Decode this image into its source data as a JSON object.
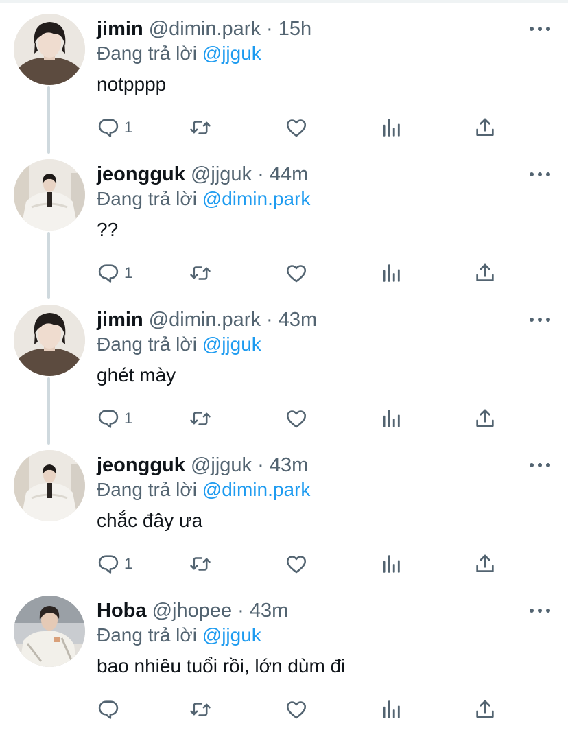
{
  "ui": {
    "reply_label": "Đang trả lời",
    "dot": "·"
  },
  "tweets": [
    {
      "name": "jimin",
      "handle": "@dimin.park",
      "time": "15h",
      "reply_to": "@jjguk",
      "text": "notpppp",
      "reply_count": "1",
      "avatar": "avatar-jimin"
    },
    {
      "name": "jeongguk",
      "handle": "@jjguk",
      "time": "44m",
      "reply_to": "@dimin.park",
      "text": "??",
      "reply_count": "1",
      "avatar": "avatar-jeongguk"
    },
    {
      "name": "jimin",
      "handle": "@dimin.park",
      "time": "43m",
      "reply_to": "@jjguk",
      "text": "ghét mày",
      "reply_count": "1",
      "avatar": "avatar-jimin"
    },
    {
      "name": "jeongguk",
      "handle": "@jjguk",
      "time": "43m",
      "reply_to": "@dimin.park",
      "text": "chắc đây ưa",
      "reply_count": "1",
      "avatar": "avatar-jeongguk"
    },
    {
      "name": "Hoba",
      "handle": "@jhopee",
      "time": "43m",
      "reply_to": "@jjguk",
      "text": "bao nhiêu tuổi rồi, lớn dùm đi",
      "reply_count": "",
      "avatar": "avatar-hoba"
    }
  ],
  "colors": {
    "accent": "#1d9bf0",
    "secondary_text": "#536471",
    "primary_text": "#0f1419",
    "thread_line": "#cfd9de"
  },
  "icons": [
    "reply-icon",
    "retweet-icon",
    "like-icon",
    "views-icon",
    "share-icon",
    "more-icon"
  ]
}
